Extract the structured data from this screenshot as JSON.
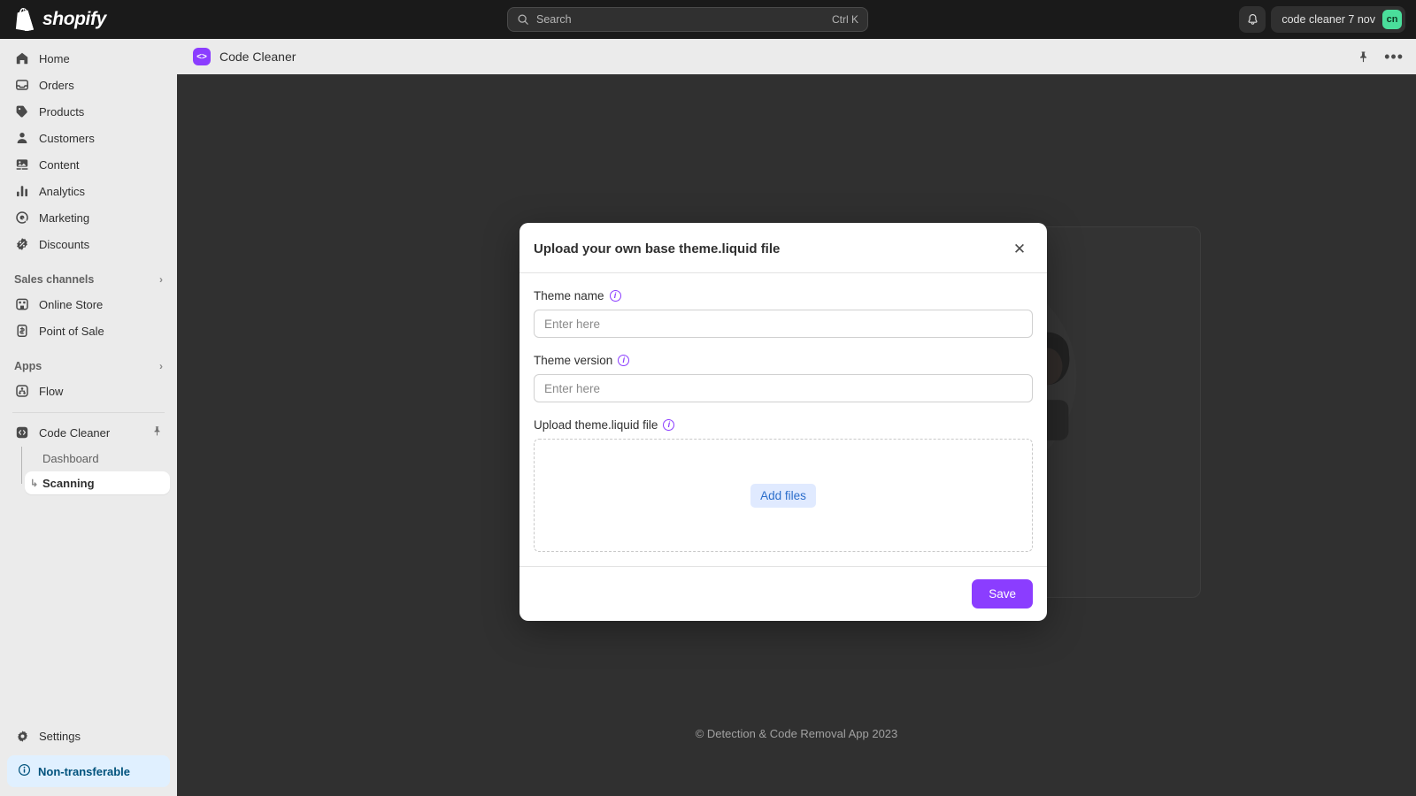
{
  "topbar": {
    "brand": "shopify",
    "brand_icon": "shopify-bag-logo",
    "search": {
      "placeholder": "Search",
      "shortcut": "Ctrl K",
      "icon": "search-icon"
    },
    "notifications_icon": "bell-icon",
    "account": {
      "name": "code cleaner 7 nov",
      "initials": "cn",
      "avatar_color": "#4ade9b"
    }
  },
  "sidebar": {
    "items": [
      {
        "label": "Home",
        "icon": "home-icon"
      },
      {
        "label": "Orders",
        "icon": "orders-inbox-icon"
      },
      {
        "label": "Products",
        "icon": "products-tag-icon"
      },
      {
        "label": "Customers",
        "icon": "customers-person-icon"
      },
      {
        "label": "Content",
        "icon": "content-image-icon"
      },
      {
        "label": "Analytics",
        "icon": "analytics-bars-icon"
      },
      {
        "label": "Marketing",
        "icon": "marketing-target-icon"
      },
      {
        "label": "Discounts",
        "icon": "discounts-badge-icon"
      }
    ],
    "groups": [
      {
        "label": "Sales channels",
        "chevron": "›",
        "items": [
          {
            "label": "Online Store",
            "icon": "store-icon"
          },
          {
            "label": "Point of Sale",
            "icon": "point-of-sale-icon"
          }
        ]
      },
      {
        "label": "Apps",
        "chevron": "›",
        "items": [
          {
            "label": "Flow",
            "icon": "flow-icon"
          }
        ]
      }
    ],
    "app": {
      "label": "Code Cleaner",
      "icon": "code-brackets-icon",
      "pin_icon": "pin-icon",
      "subitems": [
        {
          "label": "Dashboard",
          "active": false
        },
        {
          "label": "Scanning",
          "active": true
        }
      ]
    },
    "settings": {
      "label": "Settings",
      "icon": "gear-icon"
    },
    "status_badge": {
      "label": "Non-transferable",
      "icon": "info-circle-icon",
      "color": "#00527c",
      "background": "#e0f0ff"
    }
  },
  "appbar": {
    "title": "Code Cleaner",
    "icon_glyph": "<>",
    "icon_color": "#8b3dff",
    "pin_icon": "pin-icon",
    "more_icon": "more-horizontal-icon"
  },
  "content": {
    "footer": "© Detection & Code Removal App 2023"
  },
  "modal": {
    "title": "Upload your own base theme.liquid file",
    "close_icon": "close-icon",
    "fields": [
      {
        "label": "Theme name",
        "info_icon": "info-circle-icon",
        "value": "",
        "placeholder": "Enter here"
      },
      {
        "label": "Theme version",
        "info_icon": "info-circle-icon",
        "value": "",
        "placeholder": "Enter here"
      }
    ],
    "upload": {
      "label": "Upload theme.liquid file",
      "info_icon": "info-circle-icon",
      "button_label": "Add files"
    },
    "save_label": "Save",
    "accent_color": "#8b3dff"
  }
}
